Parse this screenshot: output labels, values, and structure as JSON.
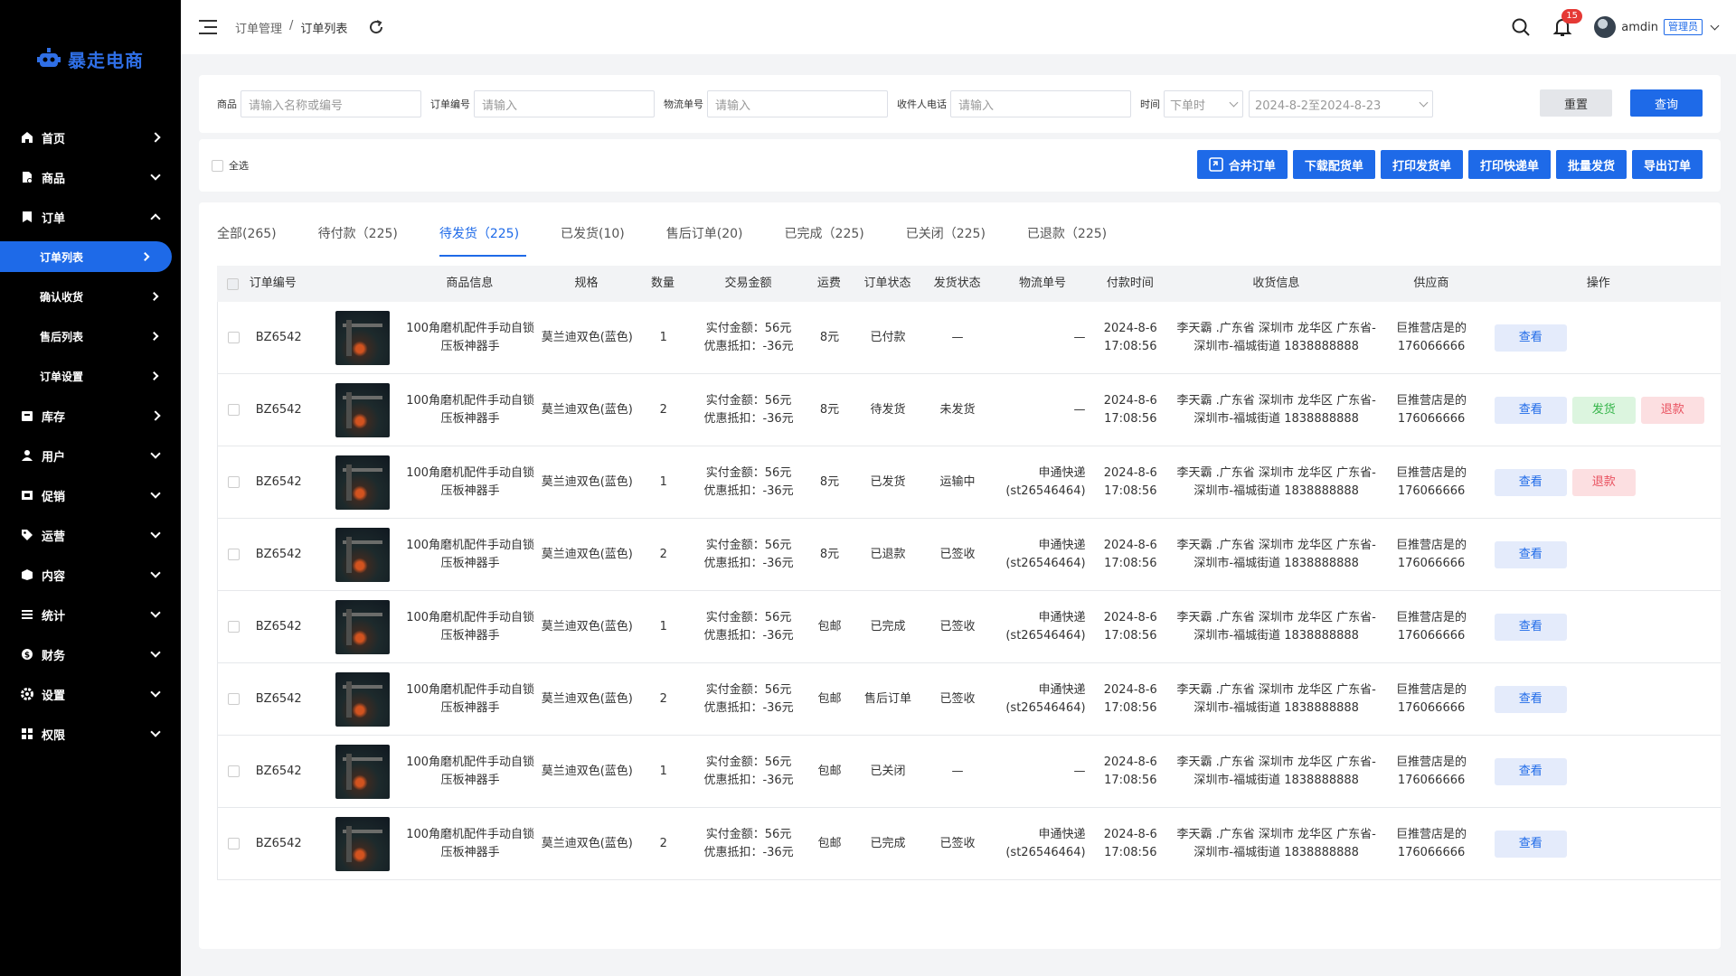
{
  "app": {
    "name": "暴走电商",
    "brand_color": "#1e6ae8"
  },
  "sidebar": {
    "items": [
      {
        "label": "首页",
        "icon": "home-icon"
      },
      {
        "label": "商品",
        "icon": "product-icon"
      },
      {
        "label": "订单",
        "icon": "order-icon"
      },
      {
        "label": "库存",
        "icon": "inventory-icon"
      },
      {
        "label": "用户",
        "icon": "user-icon"
      },
      {
        "label": "促销",
        "icon": "promotion-icon"
      },
      {
        "label": "运营",
        "icon": "tag-icon"
      },
      {
        "label": "内容",
        "icon": "content-icon"
      },
      {
        "label": "统计",
        "icon": "stats-icon"
      },
      {
        "label": "财务",
        "icon": "finance-icon"
      },
      {
        "label": "设置",
        "icon": "settings-icon"
      },
      {
        "label": "权限",
        "icon": "permission-icon"
      }
    ],
    "order_sub": [
      "订单列表",
      "确认收货",
      "售后列表",
      "订单设置"
    ]
  },
  "header": {
    "breadcrumb": [
      "订单管理",
      "订单列表"
    ],
    "sep": "/",
    "notifications": "15",
    "username": "amdin",
    "role": "管理员"
  },
  "filter": {
    "product_label": "商品",
    "product_placeholder": "请输入名称或编号",
    "order_no_label": "订单编号",
    "order_no_placeholder": "请输入",
    "logistics_label": "物流单号",
    "logistics_placeholder": "请输入",
    "phone_label": "收件人电话",
    "phone_placeholder": "请输入",
    "time_label": "时间",
    "time_type": "下单时",
    "date_range": "2024-8-2至2024-8-23",
    "reset": "重置",
    "search": "查询"
  },
  "actions": {
    "select_all": "全选",
    "buttons": [
      "合并订单",
      "下载配货单",
      "打印发货单",
      "打印快递单",
      "批量发货",
      "导出订单"
    ]
  },
  "tabs": [
    "全部(265)",
    "待付款（225)",
    "待发货（225)",
    "已发货(10)",
    "售后订单(20)",
    "已完成（225)",
    "已关闭（225)",
    "已退款（225)"
  ],
  "active_tab": 2,
  "table": {
    "headers": [
      "订单编号",
      "商品信息",
      "规格",
      "数量",
      "交易金额",
      "运费",
      "订单状态",
      "发货状态",
      "物流单号",
      "付款时间",
      "收货信息",
      "供应商",
      "操作"
    ],
    "rows": [
      {
        "no": "BZ6542",
        "name": "100角磨机配件手动自锁压板神器手",
        "spec": "莫兰迪双色(蓝色)",
        "qty": "1",
        "paid": "实付金额：56元",
        "discount": "优惠抵扣：-36元",
        "ship": "8元",
        "order_status": "已付款",
        "ship_status": "—",
        "logistics_company": "—",
        "logistics_no": "",
        "pay_date": "2024-8-6",
        "pay_time": "17:08:56",
        "addr1": "李天霸 .广东省 深圳市 龙华区 广东省-",
        "addr2": "深圳市-福城街道 1838888888",
        "sup1": "巨推营店是的",
        "sup2": "176066666",
        "ops": [
          "查看"
        ]
      },
      {
        "no": "BZ6542",
        "name": "100角磨机配件手动自锁压板神器手",
        "spec": "莫兰迪双色(蓝色)",
        "qty": "2",
        "paid": "实付金额：56元",
        "discount": "优惠抵扣：-36元",
        "ship": "8元",
        "order_status": "待发货",
        "ship_status": "未发货",
        "logistics_company": "—",
        "logistics_no": "",
        "pay_date": "2024-8-6",
        "pay_time": "17:08:56",
        "addr1": "李天霸 .广东省 深圳市 龙华区 广东省-",
        "addr2": "深圳市-福城街道 1838888888",
        "sup1": "巨推营店是的",
        "sup2": "176066666",
        "ops": [
          "查看",
          "发货",
          "退款"
        ]
      },
      {
        "no": "BZ6542",
        "name": "100角磨机配件手动自锁压板神器手",
        "spec": "莫兰迪双色(蓝色)",
        "qty": "1",
        "paid": "实付金额：56元",
        "discount": "优惠抵扣：-36元",
        "ship": "8元",
        "order_status": "已发货",
        "ship_status": "运输中",
        "logistics_company": "申通快递",
        "logistics_no": "(st26546464)",
        "pay_date": "2024-8-6",
        "pay_time": "17:08:56",
        "addr1": "李天霸 .广东省 深圳市 龙华区 广东省-",
        "addr2": "深圳市-福城街道 1838888888",
        "sup1": "巨推营店是的",
        "sup2": "176066666",
        "ops": [
          "查看",
          "退款"
        ]
      },
      {
        "no": "BZ6542",
        "name": "100角磨机配件手动自锁压板神器手",
        "spec": "莫兰迪双色(蓝色)",
        "qty": "2",
        "paid": "实付金额：56元",
        "discount": "优惠抵扣：-36元",
        "ship": "8元",
        "order_status": "已退款",
        "ship_status": "已签收",
        "logistics_company": "申通快递",
        "logistics_no": "(st26546464)",
        "pay_date": "2024-8-6",
        "pay_time": "17:08:56",
        "addr1": "李天霸 .广东省 深圳市 龙华区 广东省-",
        "addr2": "深圳市-福城街道 1838888888",
        "sup1": "巨推营店是的",
        "sup2": "176066666",
        "ops": [
          "查看"
        ]
      },
      {
        "no": "BZ6542",
        "name": "100角磨机配件手动自锁压板神器手",
        "spec": "莫兰迪双色(蓝色)",
        "qty": "1",
        "paid": "实付金额：56元",
        "discount": "优惠抵扣：-36元",
        "ship": "包邮",
        "order_status": "已完成",
        "ship_status": "已签收",
        "logistics_company": "申通快递",
        "logistics_no": "(st26546464)",
        "pay_date": "2024-8-6",
        "pay_time": "17:08:56",
        "addr1": "李天霸 .广东省 深圳市 龙华区 广东省-",
        "addr2": "深圳市-福城街道 1838888888",
        "sup1": "巨推营店是的",
        "sup2": "176066666",
        "ops": [
          "查看"
        ]
      },
      {
        "no": "BZ6542",
        "name": "100角磨机配件手动自锁压板神器手",
        "spec": "莫兰迪双色(蓝色)",
        "qty": "2",
        "paid": "实付金额：56元",
        "discount": "优惠抵扣：-36元",
        "ship": "包邮",
        "order_status": "售后订单",
        "ship_status": "已签收",
        "logistics_company": "申通快递",
        "logistics_no": "(st26546464)",
        "pay_date": "2024-8-6",
        "pay_time": "17:08:56",
        "addr1": "李天霸 .广东省 深圳市 龙华区 广东省-",
        "addr2": "深圳市-福城街道 1838888888",
        "sup1": "巨推营店是的",
        "sup2": "176066666",
        "ops": [
          "查看"
        ]
      },
      {
        "no": "BZ6542",
        "name": "100角磨机配件手动自锁压板神器手",
        "spec": "莫兰迪双色(蓝色)",
        "qty": "1",
        "paid": "实付金额：56元",
        "discount": "优惠抵扣：-36元",
        "ship": "包邮",
        "order_status": "已关闭",
        "ship_status": "—",
        "logistics_company": "—",
        "logistics_no": "",
        "pay_date": "2024-8-6",
        "pay_time": "17:08:56",
        "addr1": "李天霸 .广东省 深圳市 龙华区 广东省-",
        "addr2": "深圳市-福城街道 1838888888",
        "sup1": "巨推营店是的",
        "sup2": "176066666",
        "ops": [
          "查看"
        ]
      },
      {
        "no": "BZ6542",
        "name": "100角磨机配件手动自锁压板神器手",
        "spec": "莫兰迪双色(蓝色)",
        "qty": "2",
        "paid": "实付金额：56元",
        "discount": "优惠抵扣：-36元",
        "ship": "包邮",
        "order_status": "已完成",
        "ship_status": "已签收",
        "logistics_company": "申通快递",
        "logistics_no": "(st26546464)",
        "pay_date": "2024-8-6",
        "pay_time": "17:08:56",
        "addr1": "李天霸 .广东省 深圳市 龙华区 广东省-",
        "addr2": "深圳市-福城街道 1838888888",
        "sup1": "巨推营店是的",
        "sup2": "176066666",
        "ops": [
          "查看"
        ]
      }
    ]
  }
}
